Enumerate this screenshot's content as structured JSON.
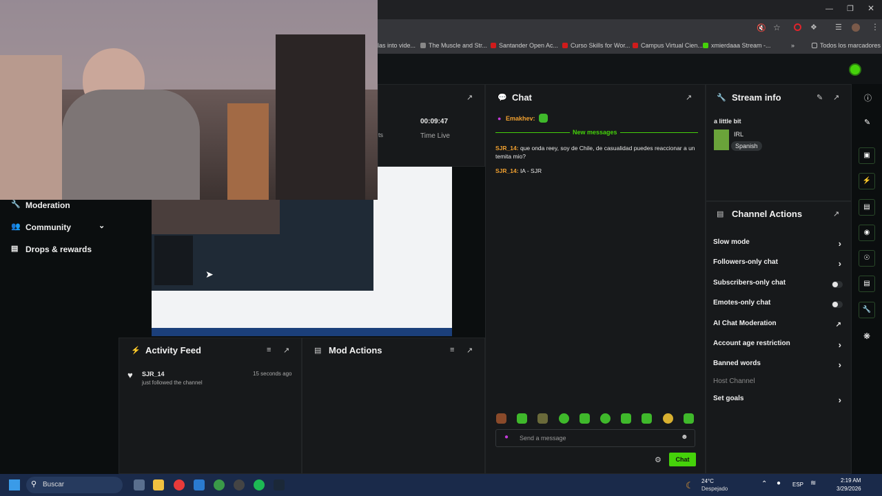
{
  "browser": {
    "bookmarks": [
      {
        "label": "las into vide...",
        "color": "#555"
      },
      {
        "label": "The Muscle and Str...",
        "color": "#888"
      },
      {
        "label": "Santander Open Ac...",
        "color": "#d01b1b"
      },
      {
        "label": "Curso Skills for Wor...",
        "color": "#d01b1b"
      },
      {
        "label": "Campus Virtual Cien...",
        "color": "#d01b1b"
      },
      {
        "label": "xmierdaaa Stream -...",
        "color": "#45d20a"
      }
    ],
    "all_bookmarks": "Todos los marcadores"
  },
  "sidebar": {
    "items": [
      {
        "label": "Moderation",
        "icon": "wrench-icon"
      },
      {
        "label": "Community",
        "icon": "people-icon"
      },
      {
        "label": "Drops & rewards",
        "icon": "gift-icon"
      }
    ]
  },
  "stats": {
    "time_value": "00:09:47",
    "time_label": "Time Live",
    "partial_label": "ts"
  },
  "chat": {
    "title": "Chat",
    "pinned_user": "Emakhev:",
    "new_messages_label": "New messages",
    "messages": [
      {
        "user": "SJR_14:",
        "text": "que onda reey, soy de Chile, de casualidad puedes reaccionar a un temita mio?"
      },
      {
        "user": "SJR_14:",
        "text": "IA - SJR"
      }
    ],
    "placeholder": "Send a message",
    "send_label": "Chat"
  },
  "stream_info": {
    "title": "Stream info",
    "stream_title": "a little bit",
    "category": "IRL",
    "language_tag": "Spanish"
  },
  "channel_actions": {
    "title": "Channel Actions",
    "items": [
      {
        "label": "Slow mode",
        "control": "chevron"
      },
      {
        "label": "Followers-only chat",
        "control": "chevron"
      },
      {
        "label": "Subscribers-only chat",
        "control": "toggle"
      },
      {
        "label": "Emotes-only chat",
        "control": "toggle"
      },
      {
        "label": "AI Chat Moderation",
        "control": "external"
      },
      {
        "label": "Account age restriction",
        "control": "chevron"
      },
      {
        "label": "Banned words",
        "control": "chevron"
      },
      {
        "label": "Host Channel",
        "control": "none"
      },
      {
        "label": "Set goals",
        "control": "chevron"
      }
    ]
  },
  "activity_feed": {
    "title": "Activity Feed",
    "events": [
      {
        "user": "SJR_14",
        "action": "just followed the channel",
        "time": "15 seconds ago"
      }
    ]
  },
  "mod_actions": {
    "title": "Mod Actions"
  },
  "taskbar": {
    "search_label": "Buscar",
    "weather_temp": "24°C",
    "weather_desc": "Despejado",
    "lang": "ESP",
    "time": "2:19 AM",
    "date": "3/29/2026"
  },
  "colors": {
    "accent": "#45d20a",
    "panel": "#17191b",
    "username": "#f0a030"
  }
}
